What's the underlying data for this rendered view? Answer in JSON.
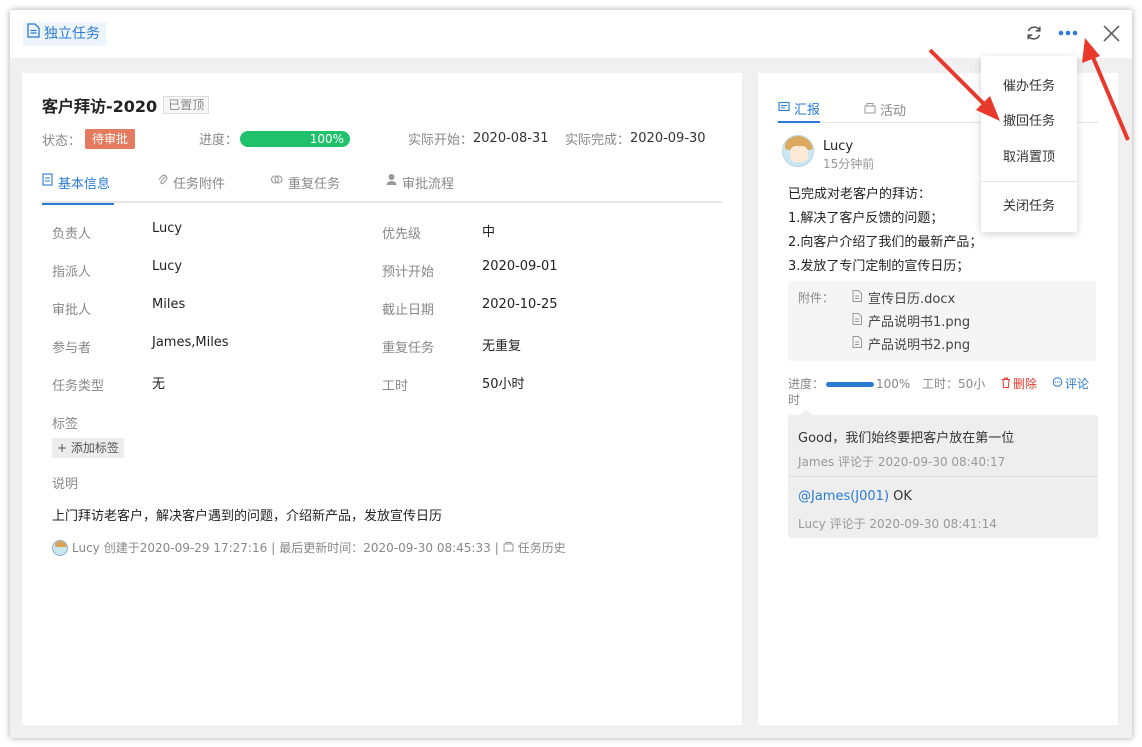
{
  "header": {
    "title": "独立任务"
  },
  "task": {
    "title": "客户拜访-2020",
    "pin_badge": "已置顶",
    "status_label": "状态：",
    "status_value": "待审批",
    "progress_label": "进度：",
    "progress_value": "100%",
    "progress_fraction": 1.0,
    "actual_start_label": "实际开始：",
    "actual_start": "2020-08-31",
    "actual_end_label": "实际完成：",
    "actual_end": "2020-09-30"
  },
  "tabs": [
    {
      "label": "基本信息",
      "active": true
    },
    {
      "label": "任务附件",
      "active": false
    },
    {
      "label": "重复任务",
      "active": false
    },
    {
      "label": "审批流程",
      "active": false
    }
  ],
  "fields_left": [
    {
      "label": "负责人",
      "value": "Lucy"
    },
    {
      "label": "指派人",
      "value": "Lucy"
    },
    {
      "label": "审批人",
      "value": "Miles"
    },
    {
      "label": "参与者",
      "value": "James,Miles"
    },
    {
      "label": "任务类型",
      "value": "无"
    }
  ],
  "fields_right": [
    {
      "label": "优先级",
      "value": "中"
    },
    {
      "label": "预计开始",
      "value": "2020-09-01"
    },
    {
      "label": "截止日期",
      "value": "2020-10-25"
    },
    {
      "label": "重复任务",
      "value": "无重复"
    },
    {
      "label": "工时",
      "value": "50小时"
    }
  ],
  "tags_label": "标签",
  "add_tag": "添加标签",
  "desc_label": "说明",
  "description": "上门拜访老客户，解决客户遇到的问题，介绍新产品，发放宣传日历",
  "footer": {
    "user": "Lucy",
    "created": "创建于2020-09-29 17:27:16",
    "sep1": "|",
    "updated": "最后更新时间：2020-09-30 08:45:33",
    "sep2": "|",
    "history": "任务历史"
  },
  "right": {
    "tabs": [
      {
        "label": "汇报",
        "active": true
      },
      {
        "label": "活动",
        "active": false
      }
    ],
    "reporter": "Lucy",
    "report_time": "15分钟前",
    "report_lines": [
      "已完成对老客户的拜访：",
      "1.解决了客户反馈的问题；",
      "2.向客户介绍了我们的最新产品；",
      "3.发放了专门定制的宣传日历；"
    ],
    "attach_label": "附件：",
    "attachments": [
      "宣传日历.docx",
      "产品说明书1.png",
      "产品说明书2.png"
    ],
    "progress_label": "进度：",
    "progress_value": "100%",
    "work_hours_label": "工时：",
    "work_hours_1": "50小",
    "work_hours_2": "时",
    "delete_label": "删除",
    "comment_label": "评论",
    "comments": [
      {
        "text": "Good，我们始终要把客户放在第一位",
        "meta": "James 评论于 2020-09-30 08:40:17"
      },
      {
        "mention": "@James(J001)",
        "text": " OK",
        "meta": "Lucy 评论于 2020-09-30 08:41:14"
      }
    ]
  },
  "menu": {
    "items": [
      "催办任务",
      "撤回任务",
      "取消置顶",
      "关闭任务"
    ]
  },
  "colors": {
    "accent": "#2a7bd1",
    "status": "#e47a5e",
    "progress": "#1fc26a",
    "annotation_arrow": "#e8392c"
  }
}
